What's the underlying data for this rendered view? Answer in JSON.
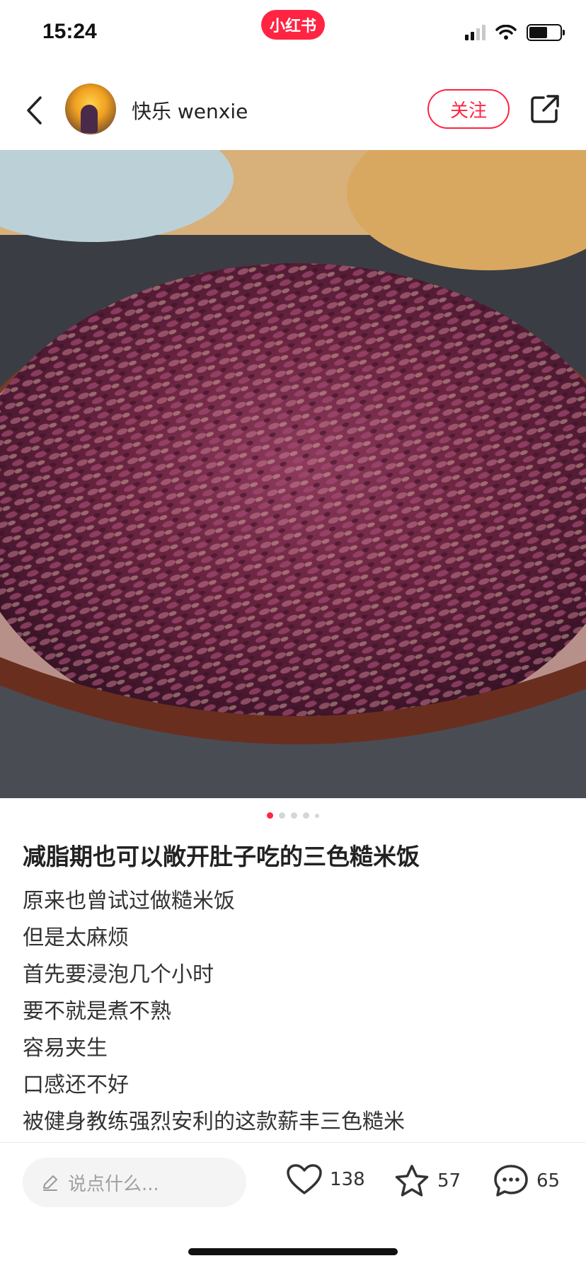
{
  "status_bar": {
    "time": "15:24",
    "app_badge": "小红书"
  },
  "header": {
    "author_name": "快乐 wenxie",
    "follow_label": "关注"
  },
  "carousel": {
    "image_count": 5,
    "active_index": 0
  },
  "post": {
    "title": "减脂期也可以敞开肚子吃的三色糙米饭",
    "lines": [
      "原来也曾试过做糙米饭",
      "但是太麻烦",
      "首先要浸泡几个小时",
      "要不就是煮不熟",
      "容易夹生",
      "口感还不好",
      "被健身教练强烈安利的这款薪丰三色糙米"
    ]
  },
  "bottom_bar": {
    "comment_placeholder": "说点什么...",
    "likes": "138",
    "favorites": "57",
    "comments": "65"
  },
  "colors": {
    "accent": "#ff2442"
  }
}
